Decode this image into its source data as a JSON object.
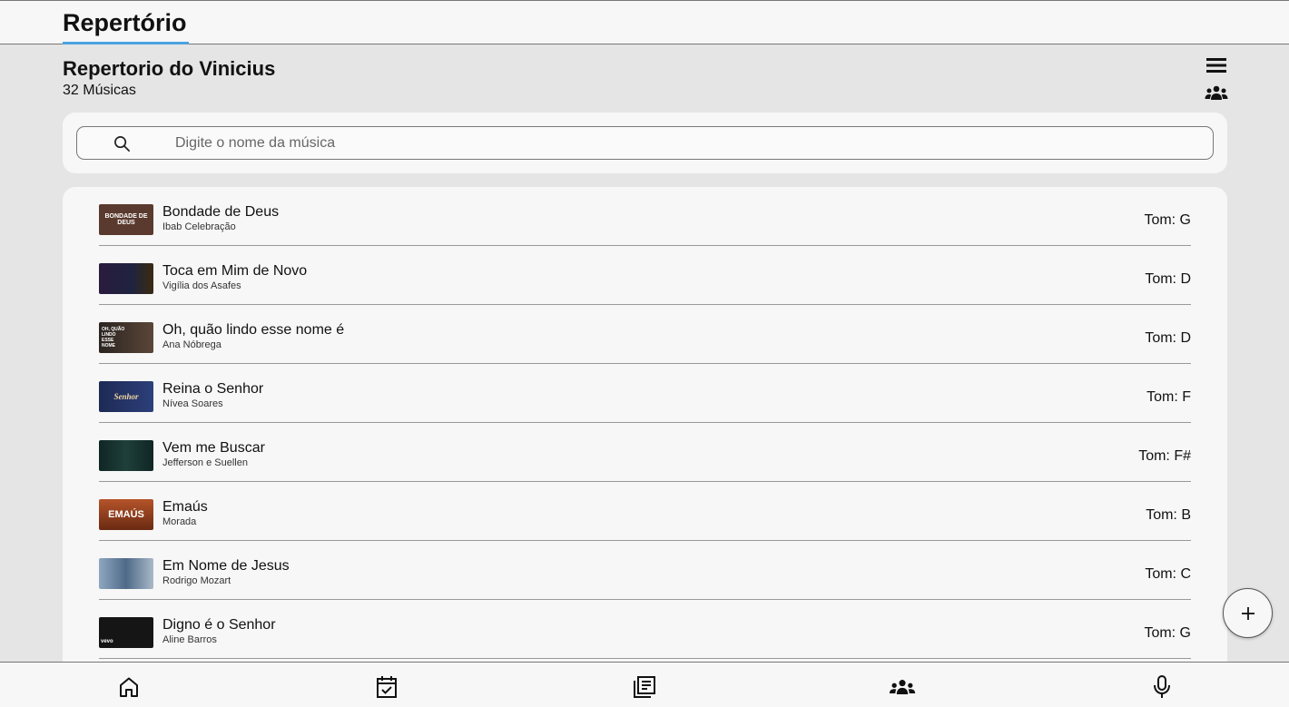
{
  "topbar": {
    "active_tab": "Repertório"
  },
  "header": {
    "title": "Repertorio do Vinicius",
    "subtitle": "32 Músicas"
  },
  "header_icons": {
    "menu": "menu-icon",
    "group": "group-icon"
  },
  "search": {
    "placeholder": "Digite o nome da música",
    "value": "",
    "icon": "search-icon"
  },
  "songs": [
    {
      "title": "Bondade de Deus",
      "artist": "Ibab Celebração",
      "key": "Tom: G",
      "thumb_text": "BONDADE DE DEUS",
      "thumb_bg": "#5a3a2e"
    },
    {
      "title": "Toca em Mim de Novo",
      "artist": "Vigília dos Asafes",
      "key": "Tom: D",
      "thumb_text": "",
      "thumb_bg": "#1e2340"
    },
    {
      "title": "Oh, quão lindo esse nome é",
      "artist": "Ana Nóbrega",
      "key": "Tom: D",
      "thumb_text": "OH, QUÃO LINDO ESSE NOME",
      "thumb_bg": "#3b302b"
    },
    {
      "title": "Reina o Senhor",
      "artist": "Nívea Soares",
      "key": "Tom: F",
      "thumb_text": "Senhor",
      "thumb_bg": "#1d2a55"
    },
    {
      "title": "Vem me Buscar",
      "artist": "Jefferson e Suellen",
      "key": "Tom: F#",
      "thumb_text": "",
      "thumb_bg": "#12302d"
    },
    {
      "title": "Emaús",
      "artist": "Morada",
      "key": "Tom: B",
      "thumb_text": "EMAÚS",
      "thumb_bg": "#8a3a1a"
    },
    {
      "title": "Em Nome de Jesus",
      "artist": "Rodrigo Mozart",
      "key": "Tom: C",
      "thumb_text": "",
      "thumb_bg": "#6e8aa8"
    },
    {
      "title": "Digno é o Senhor",
      "artist": "Aline Barros",
      "key": "Tom: G",
      "thumb_text": "vevo",
      "thumb_bg": "#151515"
    }
  ],
  "fab": {
    "icon": "plus-icon"
  },
  "bottom_nav": [
    {
      "name": "home-icon"
    },
    {
      "name": "calendar-check-icon"
    },
    {
      "name": "article-icon"
    },
    {
      "name": "groups-icon"
    },
    {
      "name": "microphone-icon"
    }
  ],
  "colors": {
    "accent": "#4aa3df",
    "background": "#e5e5e5",
    "card": "#f7f7f7"
  }
}
